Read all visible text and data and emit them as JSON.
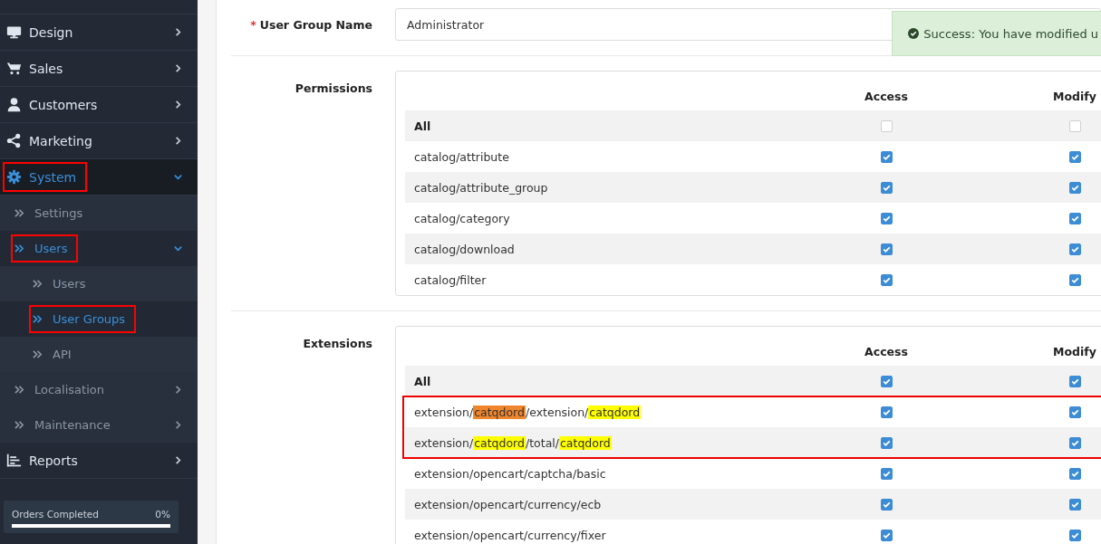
{
  "sidebar": {
    "items": [
      {
        "label": "Design",
        "kind": "group",
        "expanded": false,
        "selected": false,
        "outlined": false
      },
      {
        "label": "Sales",
        "kind": "group",
        "expanded": false,
        "selected": false,
        "outlined": false
      },
      {
        "label": "Customers",
        "kind": "group",
        "expanded": false,
        "selected": false,
        "outlined": false
      },
      {
        "label": "Marketing",
        "kind": "group",
        "expanded": false,
        "selected": false,
        "outlined": false
      },
      {
        "label": "System",
        "kind": "group",
        "expanded": true,
        "selected": true,
        "outlined": true,
        "children": [
          {
            "label": "Settings",
            "kind": "link",
            "selected": false,
            "outlined": false
          },
          {
            "label": "Users",
            "kind": "group",
            "expanded": true,
            "selected": true,
            "outlined": true,
            "children": [
              {
                "label": "Users",
                "kind": "link",
                "selected": false,
                "outlined": false
              },
              {
                "label": "User Groups",
                "kind": "link",
                "selected": true,
                "outlined": true
              },
              {
                "label": "API",
                "kind": "link",
                "selected": false,
                "outlined": false
              }
            ]
          },
          {
            "label": "Localisation",
            "kind": "group",
            "expanded": false,
            "selected": false,
            "outlined": false
          },
          {
            "label": "Maintenance",
            "kind": "group",
            "expanded": false,
            "selected": false,
            "outlined": false
          }
        ]
      },
      {
        "label": "Reports",
        "kind": "group",
        "expanded": false,
        "selected": false,
        "outlined": false
      }
    ],
    "progress": {
      "label": "Orders Completed",
      "reading": "0%",
      "level": 0
    }
  },
  "form": {
    "name_label": "User Group Name",
    "required_mark": "*",
    "name_value": "Administrator"
  },
  "toast": {
    "text": "Success: You have modified u"
  },
  "sections": [
    {
      "label": "Permissions",
      "columns": [
        "Access",
        "Modify"
      ],
      "row_groups": [
        {
          "outlined": false,
          "rows": [
            {
              "kind": "all",
              "path": [
                {
                  "text": "All"
                }
              ],
              "access": false,
              "modify": false
            },
            {
              "kind": "route",
              "path": [
                {
                  "text": "catalog/attribute"
                }
              ],
              "access": true,
              "modify": true
            },
            {
              "kind": "route",
              "path": [
                {
                  "text": "catalog/attribute_group"
                }
              ],
              "access": true,
              "modify": true
            },
            {
              "kind": "route",
              "path": [
                {
                  "text": "catalog/category"
                }
              ],
              "access": true,
              "modify": true
            },
            {
              "kind": "route",
              "path": [
                {
                  "text": "catalog/download"
                }
              ],
              "access": true,
              "modify": true
            },
            {
              "kind": "route",
              "path": [
                {
                  "text": "catalog/filter"
                }
              ],
              "access": true,
              "modify": true
            }
          ]
        }
      ]
    },
    {
      "label": "Extensions",
      "columns": [
        "Access",
        "Modify"
      ],
      "row_groups": [
        {
          "outlined": false,
          "rows": [
            {
              "kind": "all",
              "path": [
                {
                  "text": "All"
                }
              ],
              "access": true,
              "modify": true
            }
          ]
        },
        {
          "outlined": true,
          "rows": [
            {
              "kind": "route",
              "path": [
                {
                  "text": "extension/"
                },
                {
                  "text": "catqdord",
                  "color": "#f0862c"
                },
                {
                  "text": "/extension/"
                },
                {
                  "text": "catqdord",
                  "color": "#ffff00"
                }
              ],
              "access": true,
              "modify": true
            },
            {
              "kind": "route",
              "path": [
                {
                  "text": "extension/"
                },
                {
                  "text": "catqdord",
                  "color": "#ffff00"
                },
                {
                  "text": "/total/"
                },
                {
                  "text": "catqdord",
                  "color": "#ffff00"
                }
              ],
              "access": true,
              "modify": true
            }
          ]
        },
        {
          "outlined": false,
          "rows": [
            {
              "kind": "route",
              "path": [
                {
                  "text": "extension/opencart/captcha/basic"
                }
              ],
              "access": true,
              "modify": true
            },
            {
              "kind": "route",
              "path": [
                {
                  "text": "extension/opencart/currency/ecb"
                }
              ],
              "access": true,
              "modify": true
            },
            {
              "kind": "route",
              "path": [
                {
                  "text": "extension/opencart/currency/fixer"
                }
              ],
              "access": true,
              "modify": true
            }
          ]
        }
      ]
    }
  ]
}
